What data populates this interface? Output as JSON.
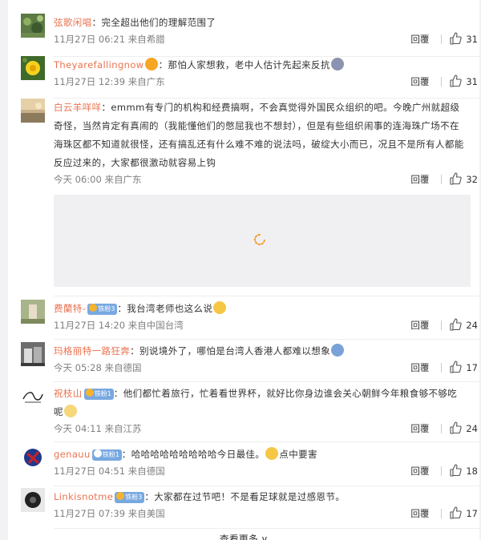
{
  "comments": [
    {
      "name": "弦歌闲唱",
      "text": "完全超出他们的理解范围了",
      "time": "11月27日 06:21",
      "source": "来自希腊",
      "reply": "回覆",
      "likes": "31"
    },
    {
      "name": "Theyarefallingnow",
      "text": "那怕人家想救，老中人估计先起来反抗",
      "time": "11月27日 12:39",
      "source": "来自广东",
      "reply": "回覆",
      "likes": "31"
    },
    {
      "name": "白云羊咩咩",
      "text1": "emmm有专门的机构和经费搞啊，不会真觉得外国民众组织的吧。今晚广州就超级",
      "text2": "奇怪，当然肯定有真闹的（我能懂他们的憋屈我也不想封），但是有些组织闹事的连海珠广场不在",
      "text3": "海珠区都不知道就很怪，还有搞乱还有什么难不难的说法吗，破绽大小而已，况且不是所有人都能",
      "text4": "反应过来的，大家都很激动就容易上钩",
      "time": "今天 06:00",
      "source": "来自广东",
      "reply": "回覆",
      "likes": "32"
    },
    {
      "name": "费蘭特-",
      "badge": "铁粉3",
      "text": "我台湾老师也这么说",
      "time": "11月27日 14:20",
      "source": "来自中国台湾",
      "reply": "回覆",
      "likes": "24"
    },
    {
      "name": "玛格丽特一路狂奔",
      "text": "别说境外了，哪怕是台湾人香港人都难以想象",
      "time": "今天 05:28",
      "source": "来自德国",
      "reply": "回覆",
      "likes": "17"
    },
    {
      "name": "祝枝山",
      "badge": "铁粉1",
      "text1": "他们都忙着旅行，忙着看世界杯，就好比你身边谁会关心朝鲜今年粮食够不够吃",
      "text2": "呢",
      "time": "今天 04:11",
      "source": "来自江苏",
      "reply": "回覆",
      "likes": "24"
    },
    {
      "name": "genauu",
      "badge": "铁粉1",
      "text_a": "哈哈哈哈哈哈哈哈哈今日最佳。",
      "text_b": "点中要害",
      "time": "11月27日 04:51",
      "source": "来自德国",
      "reply": "回覆",
      "likes": "18"
    },
    {
      "name": "Linkisnotme",
      "badge": "铁粉3",
      "text": "大家都在过节吧！不是看足球就是过感恩节。",
      "time": "11月27日 07:39",
      "source": "来自美国",
      "reply": "回覆",
      "likes": "17"
    }
  ],
  "load_more": "查看更多 ∨",
  "colors": {
    "name": "#eb7350",
    "meta": "#808080",
    "badge": "#78a8e0"
  }
}
